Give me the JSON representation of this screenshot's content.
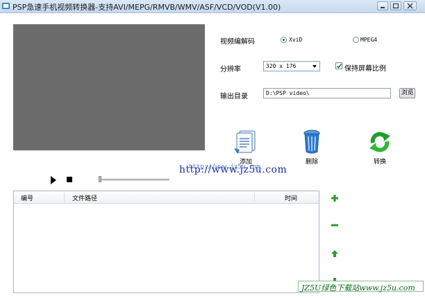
{
  "window": {
    "title": "PSP急速手机视频转换器-支持AVI/MEPG/RMVB/WMV/ASF/VCD/VOD(V1.00)",
    "buttons": [
      "minimize",
      "maximize",
      "close"
    ]
  },
  "settings": {
    "codec_label": "视频编解码",
    "codec_options": [
      {
        "label": "XviD",
        "selected": true
      },
      {
        "label": "MPEG4",
        "selected": false
      }
    ],
    "resolution_label": "分辨率",
    "resolution_value": "320 x 176",
    "keep_ratio_label": "保持屏幕比例",
    "keep_ratio_checked": true,
    "output_label": "输出目录",
    "output_value": "D:\\PSP video\\",
    "browse_label": "浏览"
  },
  "actions": {
    "add_label": "添加",
    "delete_label": "删除",
    "convert_label": "转换"
  },
  "watermark": {
    "url_large": "http://www.jz5u.com",
    "url_small": "http://www.jz5u.com",
    "badge": "JZ5U绿色下载站www.jz5u.com"
  },
  "file_list": {
    "columns": [
      "编号",
      "文件路径",
      "时间"
    ],
    "rows": []
  },
  "side_buttons": [
    "add-icon",
    "remove-icon",
    "move-up-icon",
    "move-down-icon"
  ],
  "colors": {
    "video_bg": "#6c6c6c",
    "action_green": "#1f9e2c",
    "accent_blue": "#2a69c7"
  }
}
